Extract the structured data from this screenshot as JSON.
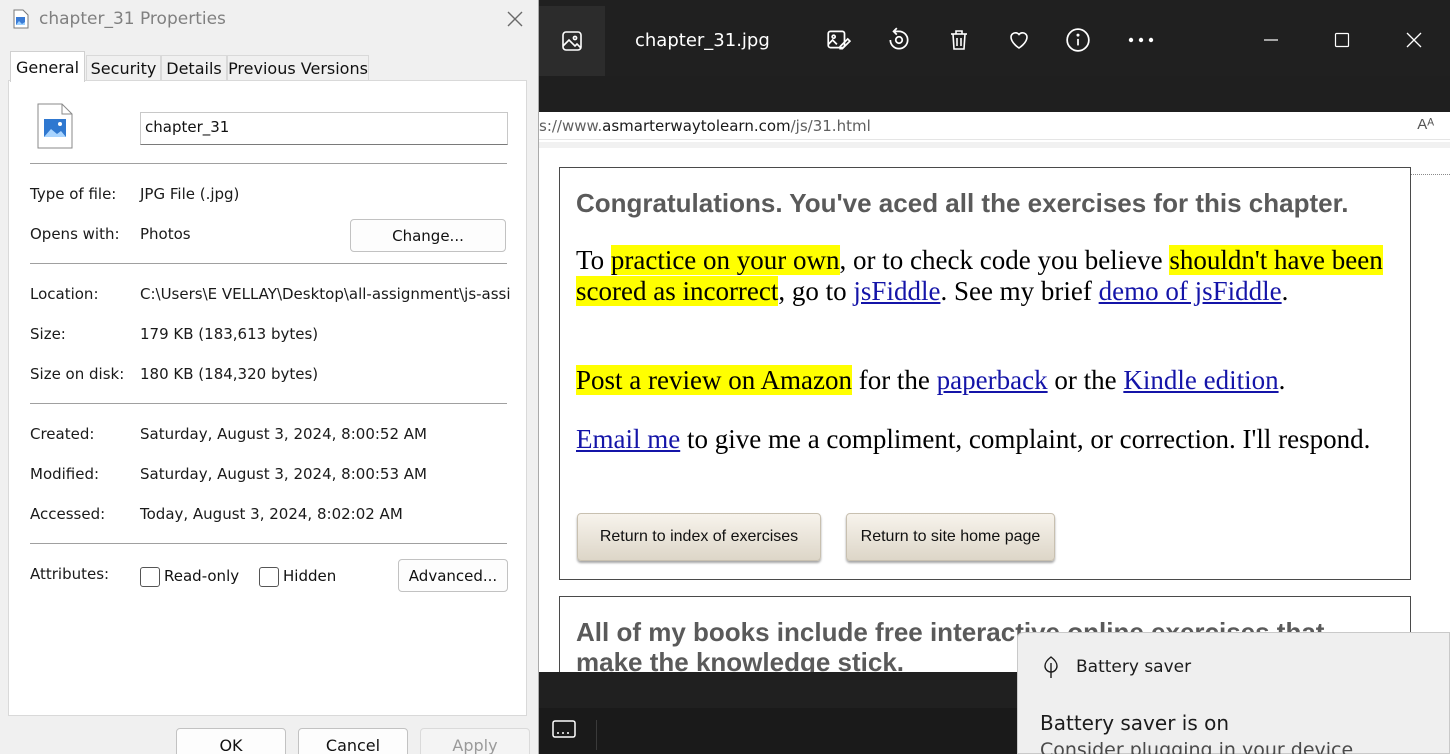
{
  "photos": {
    "filename": "chapter_31.jpg",
    "toolbar": [
      "edit-image-icon",
      "rotate-icon",
      "delete-icon",
      "favorite-icon",
      "info-icon",
      "more-icon"
    ]
  },
  "capture": {
    "url_prefix": "s://www.",
    "url_domain": "asmarterwaytolearn.com",
    "url_path": "/js/31.html",
    "read_aloud": "Aᴬ",
    "heading": "Congratulations. You've aced all the exercises for this chapter.",
    "p1": {
      "t1": "To ",
      "h1": "practice on your own",
      "t2": ", or to check code you believe ",
      "h2": "shouldn't have been scored as incorrect",
      "t3": ", go to ",
      "l1": "jsFiddle",
      "t4": ". See my brief ",
      "l2": "demo of jsFiddle",
      "t5": "."
    },
    "p2": {
      "h1": "Post a review on Amazon",
      "t1": " for the ",
      "l1": "paperback",
      "t2": " or the ",
      "l2": "Kindle edition",
      "t3": "."
    },
    "p3": {
      "l1": "Email me",
      "t1": " to give me a compliment, complaint, or correction. I'll respond."
    },
    "btn_index": "Return to index of exercises",
    "btn_home": "Return to site home page",
    "heading2": "All of my books include free interactive online exercises that make the knowledge stick."
  },
  "toast": {
    "app": "Battery saver",
    "title": "Battery saver is on",
    "body": "Consider plugging in your device"
  },
  "properties": {
    "title": "chapter_31 Properties",
    "tabs": [
      "General",
      "Security",
      "Details",
      "Previous Versions"
    ],
    "name": "chapter_31",
    "type_label": "Type of file:",
    "type_value": "JPG File (.jpg)",
    "opens_label": "Opens with:",
    "opens_value": "Photos",
    "change_btn": "Change...",
    "location_label": "Location:",
    "location_value": "C:\\Users\\E VELLAY\\Desktop\\all-assignment\\js-assig",
    "size_label": "Size:",
    "size_value": "179 KB (183,613 bytes)",
    "disk_label": "Size on disk:",
    "disk_value": "180 KB (184,320 bytes)",
    "created_label": "Created:",
    "created_value": "Saturday, August 3, 2024, 8:00:52 AM",
    "modified_label": "Modified:",
    "modified_value": "Saturday, August 3, 2024, 8:00:53 AM",
    "accessed_label": "Accessed:",
    "accessed_value": "Today, August 3, 2024, 8:02:02 AM",
    "attributes_label": "Attributes:",
    "readonly_label": "Read-only",
    "hidden_label": "Hidden",
    "advanced_btn": "Advanced...",
    "ok": "OK",
    "cancel": "Cancel",
    "apply": "Apply"
  }
}
